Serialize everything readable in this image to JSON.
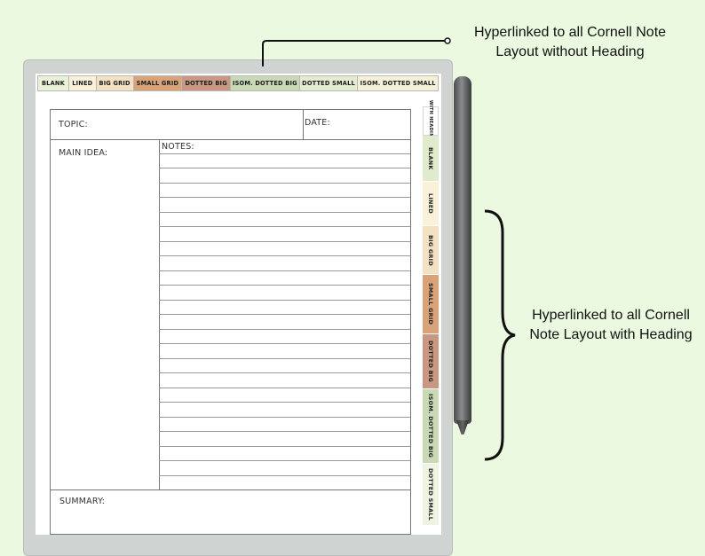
{
  "top_tabs": [
    {
      "label": "BLANK",
      "color": "#e9f1d8"
    },
    {
      "label": "LINED",
      "color": "#f9f2d9"
    },
    {
      "label": "BIG GRID",
      "color": "#f2e1c3"
    },
    {
      "label": "SMALL GRID",
      "color": "#d9a37a"
    },
    {
      "label": "DOTTED BIG",
      "color": "#c99882"
    },
    {
      "label": "ISOM. DOTTED BIG",
      "color": "#c9d9b5"
    },
    {
      "label": "DOTTED SMALL",
      "color": "#e1ecd0"
    },
    {
      "label": "ISOM. DOTTED SMALL",
      "color": "#f5f1d9"
    }
  ],
  "side_tabs": [
    {
      "label": "WITH HEADING",
      "color": "#ffffff"
    },
    {
      "label": "BLANK",
      "color": "#e0ebcd"
    },
    {
      "label": "LINED",
      "color": "#f9f2d9"
    },
    {
      "label": "BIG GRID",
      "color": "#f2e1c3"
    },
    {
      "label": "SMALL GRID",
      "color": "#d9a37a"
    },
    {
      "label": "DOTTED BIG",
      "color": "#c99882"
    },
    {
      "label": "ISOM. DOTTED BIG",
      "color": "#c9d9b5"
    },
    {
      "label": "DOTTED SMALL",
      "color": "#eef3e2"
    }
  ],
  "page": {
    "topic_label": "TOPIC:",
    "date_label": "DATE:",
    "main_idea_label": "MAIN IDEA:",
    "notes_label": "NOTES:",
    "summary_label": "SUMMARY:"
  },
  "annotations": {
    "top": "Hyperlinked to all Cornell Note Layout without Heading",
    "side": "Hyperlinked to all Cornell Note Layout with Heading"
  }
}
